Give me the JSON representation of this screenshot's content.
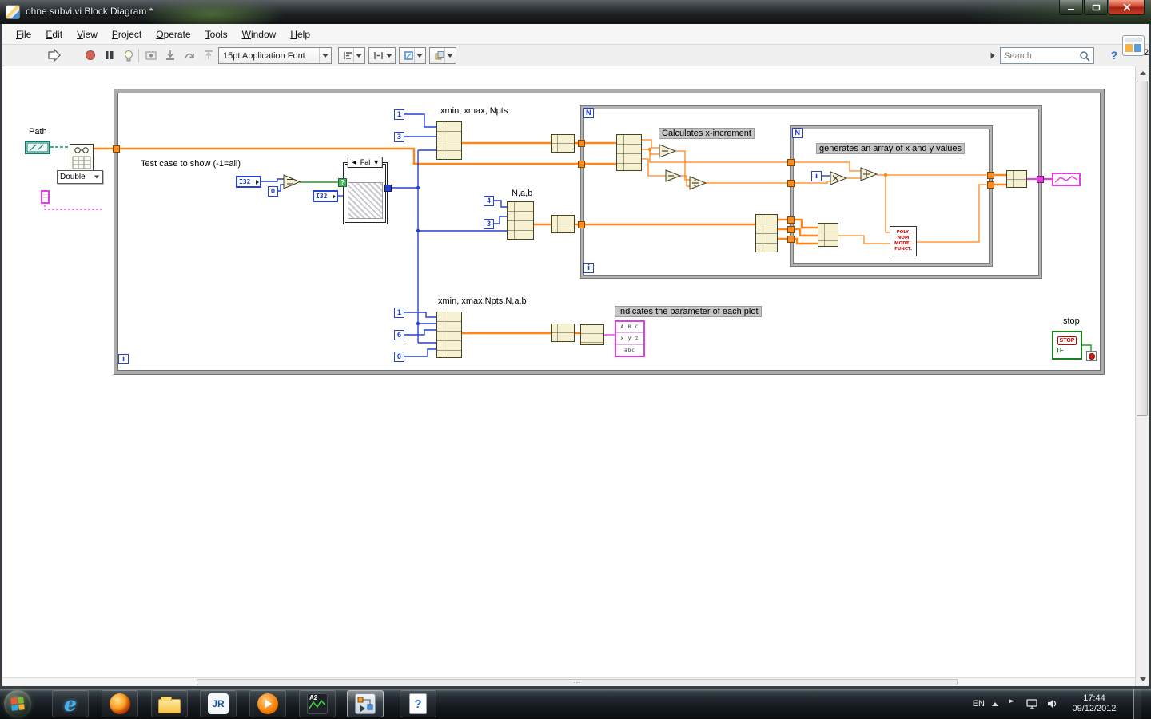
{
  "window": {
    "title": "ohne subvi.vi Block Diagram *",
    "badge": "2"
  },
  "menubar": {
    "items": [
      "File",
      "Edit",
      "View",
      "Project",
      "Operate",
      "Tools",
      "Window",
      "Help"
    ]
  },
  "toolbar": {
    "font_selector": "15pt Application Font",
    "search_placeholder": "Search",
    "help_glyph": "?"
  },
  "diagram": {
    "labels": {
      "path": "Path",
      "double_selector": "Double",
      "test_case": "Test case to show (-1=all)",
      "xmin_xmax_npts": "xmin, xmax, Npts",
      "n_a_b": "N,a,b",
      "xmin_xmax_npts_n_a_b": "xmin, xmax,Npts,N,a,b",
      "calculates": "Calculates x-increment",
      "generates": "generates an array of x and y values",
      "indicates": "Indicates the parameter of each plot",
      "stop": "stop"
    },
    "case_structure": {
      "selector": "Fal",
      "left_arrow": "◄",
      "down_arrow": "▼",
      "q": "?"
    },
    "terminals": {
      "i32": "I32",
      "n": "N",
      "i": "i",
      "stop_text": "STOP",
      "tf": "TF"
    },
    "constants": {
      "one_a": "1",
      "three_a": "3",
      "zero_cmp": "0",
      "four": "4",
      "three_b": "3",
      "one_b": "1",
      "six": "6",
      "zero_b": "0"
    },
    "polynom": [
      "POLY-",
      "NOM",
      "MODEL",
      "FUNCT."
    ],
    "string_node": [
      "A B C",
      "x y z",
      "abc"
    ]
  },
  "scrollbars": {
    "h_grip": "···"
  },
  "taskbar": {
    "buttons": {
      "ie_glyph": "e",
      "jr_label": "JR",
      "a2_label": "A2",
      "help_label": "?"
    },
    "tray": {
      "language": "EN",
      "time": "17:44",
      "date": "09/12/2012"
    }
  }
}
